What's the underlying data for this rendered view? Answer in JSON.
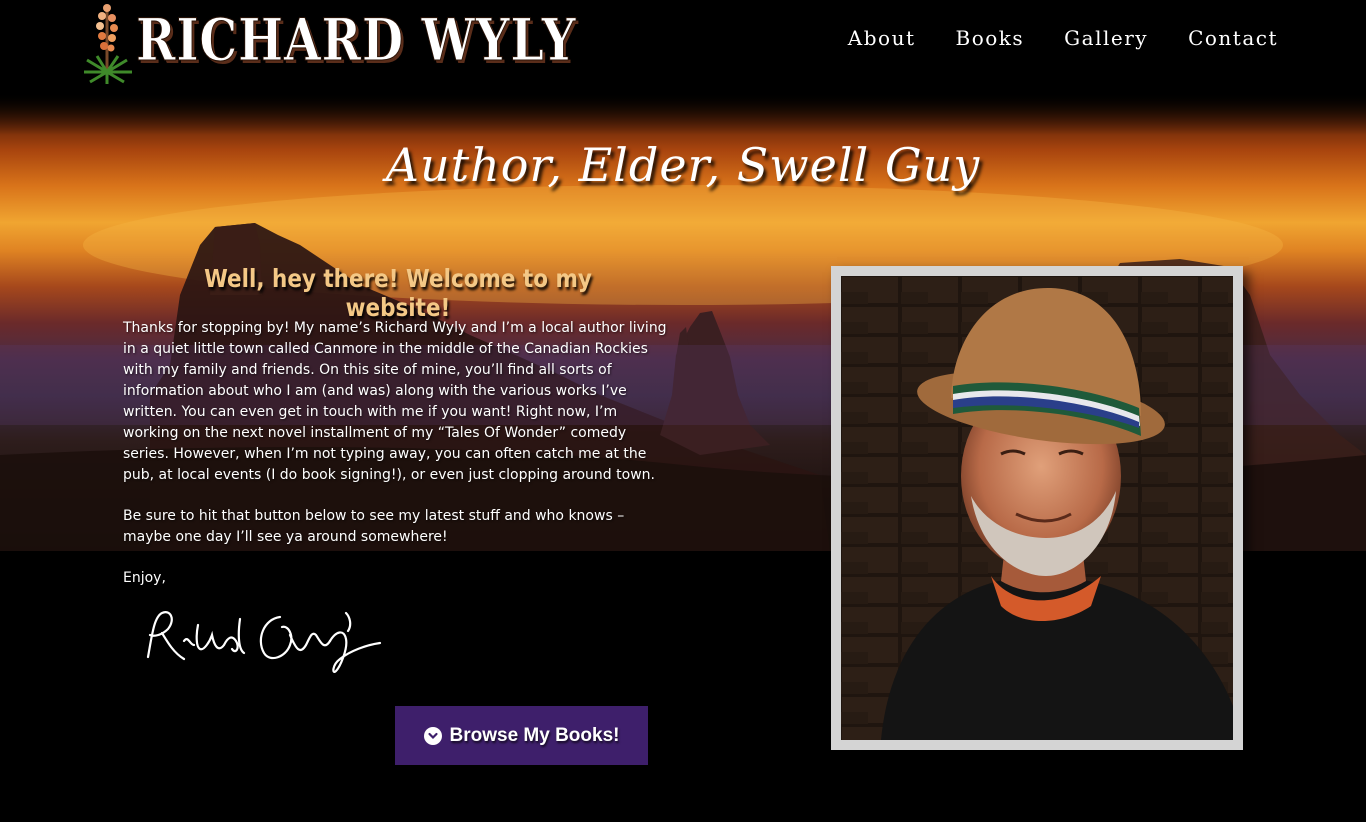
{
  "site": {
    "name": "RICHARD WYLY"
  },
  "nav": {
    "items": [
      "About",
      "Books",
      "Gallery",
      "Contact"
    ]
  },
  "hero": {
    "heading": "Author, Elder, Swell Guy",
    "welcome": "Well, hey there! Welcome to my website!"
  },
  "intro": {
    "paragraph1": "Thanks for stopping by! My name’s Richard Wyly and I’m a local author living in a quiet little town called Canmore in the middle of the Canadian Rockies with my family and friends. On this site of mine, you’ll find all sorts of information about who I am (and was) along with the various works I’ve written. You can even get in touch with me if you want! Right now, I’m working on the next novel installment of my “Tales Of Wonder” comedy series. However, when I’m not typing away, you can often catch me at the pub, at local events (I do book signing!), or even just clopping around town.",
    "paragraph2": "Be sure to hit that button below to see my latest stuff and who knows – maybe one day I’ll see ya around somewhere!",
    "signoff": "Enjoy,",
    "signature": "Richard Wyly"
  },
  "cta": {
    "label": "Browse My Books!",
    "icon": "chevron-down-circle-icon"
  },
  "colors": {
    "button": "#3e1f6b",
    "welcome_heading": "#f4c886",
    "frame": "#d4d4d4",
    "background": "#000000"
  }
}
